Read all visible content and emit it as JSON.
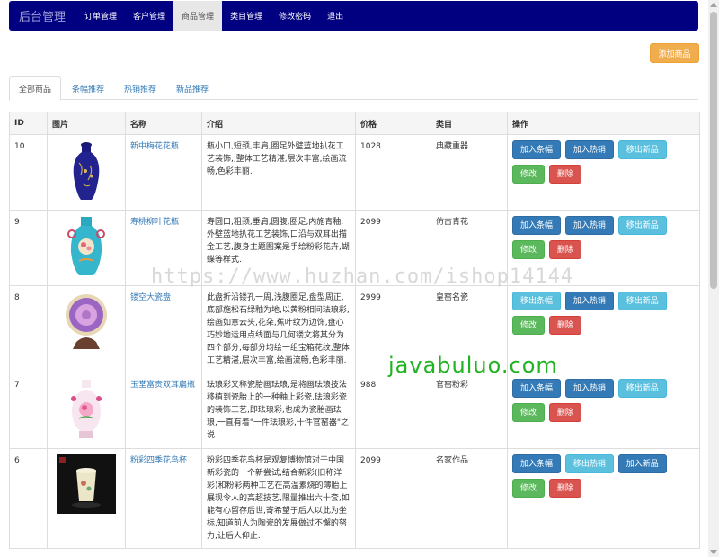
{
  "nav": {
    "brand": "后台管理",
    "items": [
      "订单管理",
      "客户管理",
      "商品管理",
      "类目管理",
      "修改密码",
      "退出"
    ],
    "active": "商品管理"
  },
  "add_button": "添加商品",
  "tabs": [
    "全部商品",
    "条幅推荐",
    "热销推荐",
    "新品推荐"
  ],
  "table": {
    "headers": [
      "ID",
      "图片",
      "名称",
      "介绍",
      "价格",
      "类目",
      "操作"
    ],
    "rows": [
      {
        "id": "10",
        "name": "新中梅花花瓶",
        "desc": "瓶小口,短颈,丰肩,圈足外壁蓝地扒花工艺装饰,,整体工艺精湛,层次丰富,绘画流畅,色彩丰丽.",
        "price": "1028",
        "category": "典藏重器",
        "actions": [
          "加入条幅",
          "加入热销",
          "移出新品"
        ],
        "image": "blue-vase"
      },
      {
        "id": "9",
        "name": "寿桃柳叶花瓶",
        "desc": "寿圆口,粗颈,垂肩,圆腹,圈足,内施青釉,外壁蓝地扒花工艺装饰,口沿与双耳出描金工艺,腹身主题图案是手绘粉彩花卉,蝴蝶等样式.",
        "price": "2099",
        "category": "仿古青花",
        "actions": [
          "加入条幅",
          "加入热销",
          "移出新品"
        ],
        "image": "turquoise-vase"
      },
      {
        "id": "8",
        "name": "镂空大瓷盘",
        "desc": "此盘折沿镂孔一周,浅腹圈足,盘型周正,底部施松石绿釉为地,以黄粉相间珐琅彩,绘画如意云头,花朵,蕉叶纹为边饰,盘心巧妙地运用点线面与几何镂文将其分为四个部分,每部分均绘一组宝箱花纹,整体工艺精湛,层次丰富,绘画流畅,色彩丰丽.",
        "price": "2999",
        "category": "皇窑名瓷",
        "actions": [
          "移出条幅",
          "加入热销",
          "移出新品"
        ],
        "image": "purple-plate"
      },
      {
        "id": "7",
        "name": "玉堂富贵双耳扁瓶",
        "desc": "珐琅彩又称瓷胎画珐琅,是将画珐琅技法移植到瓷胎上的一种釉上彩瓷,珐琅彩瓷的装饰工艺,即珐琅彩,也成为瓷胎画珐琅,一直有着\"一件珐琅彩,十件官窑器\"之说",
        "price": "988",
        "category": "官窑粉彩",
        "actions": [
          "加入条幅",
          "加入热销",
          "移出新品"
        ],
        "image": "pink-flask"
      },
      {
        "id": "6",
        "name": "粉彩四季花鸟杯",
        "desc": "粉彩四季花鸟杯是观复博物馆对于中国新彩瓷的一个新尝试,结合新彩(旧称洋彩)和粉彩两种工艺在高温素烧的薄胎上展现令人的高超技艺,限量推出六十套,如能有心留存后世,寄希望于后人以此为坐标,知道前人为陶瓷的发展做过不懈的努力,让后人仰止.",
        "price": "2099",
        "category": "名家作品",
        "actions": [
          "加入条幅",
          "移出热销",
          "加入新品"
        ],
        "image": "cup"
      }
    ],
    "common_actions": [
      "修改",
      "删除"
    ]
  },
  "watermarks": [
    "https://www.huzhan.com/ishop14144",
    "javabuluo.com"
  ]
}
